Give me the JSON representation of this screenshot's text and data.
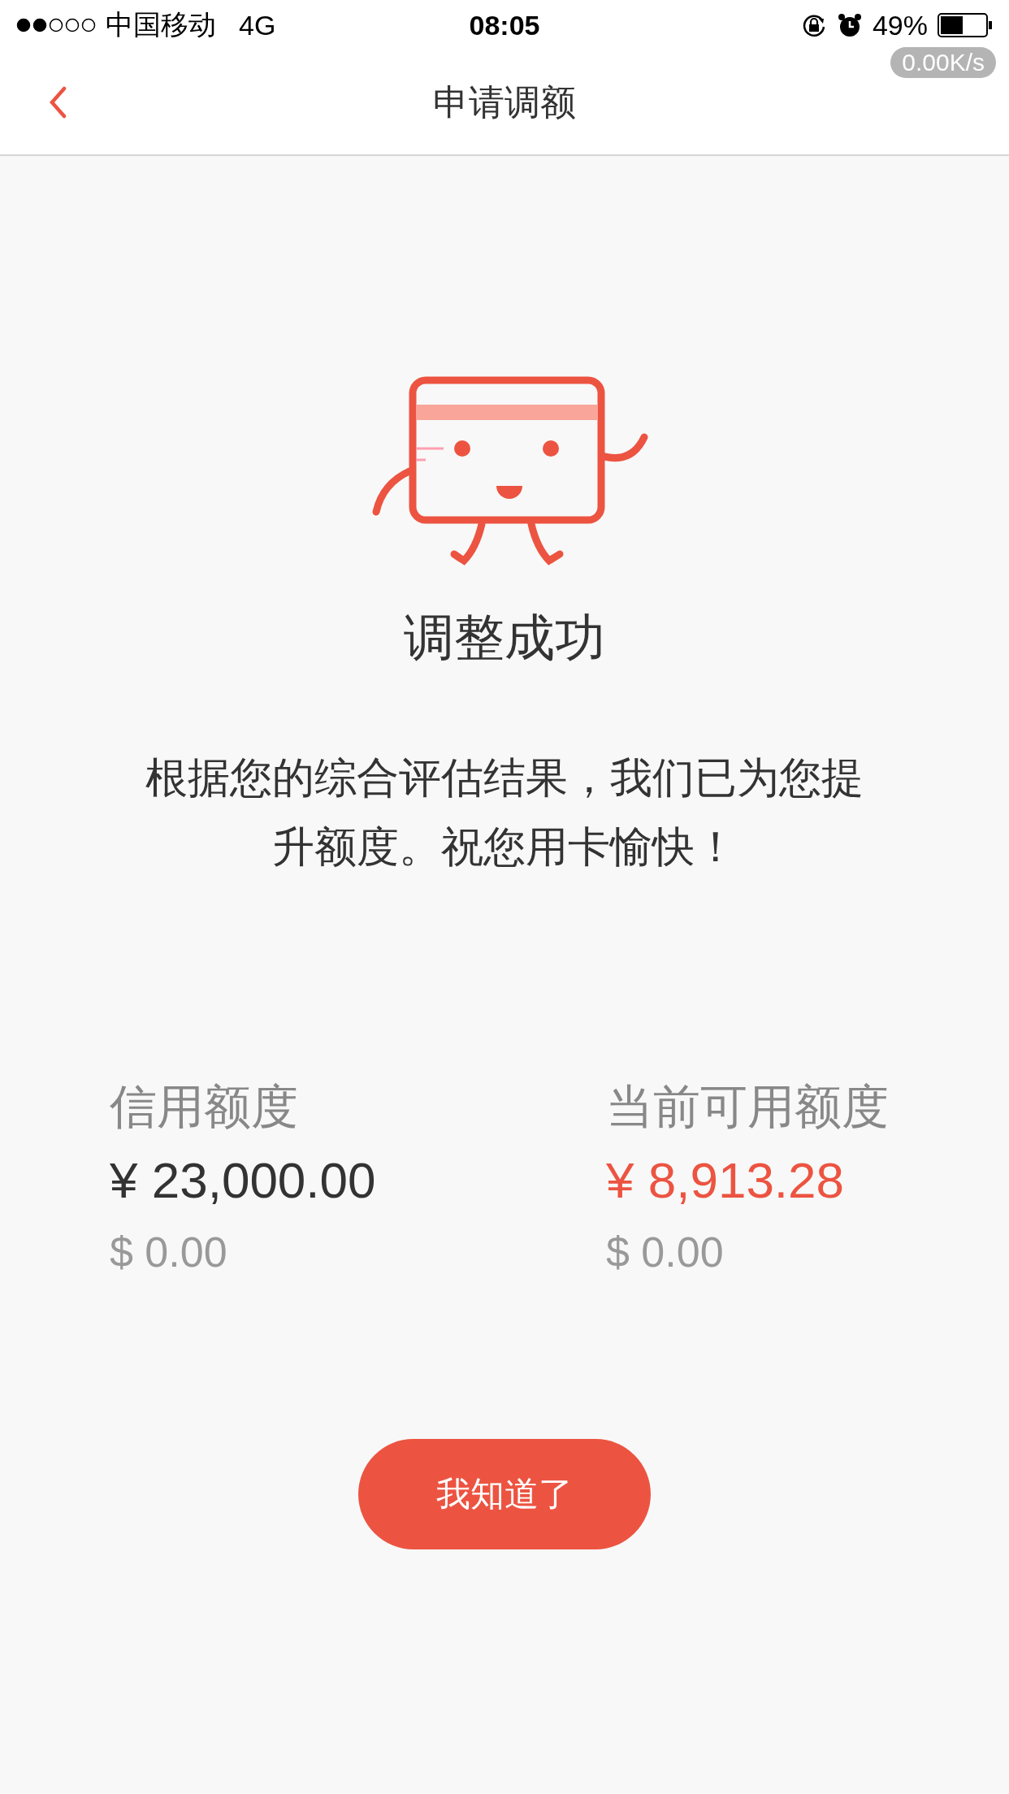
{
  "status_bar": {
    "carrier": "中国移动",
    "network": "4G",
    "time": "08:05",
    "battery": "49%",
    "speed": "0.00K/s"
  },
  "nav": {
    "title": "申请调额"
  },
  "result": {
    "title": "调整成功",
    "message": "根据您的综合评估结果，我们已为您提升额度。祝您用卡愉快！"
  },
  "limits": [
    {
      "label": "信用额度",
      "amount": "¥ 23,000.00",
      "usd": "$ 0.00",
      "highlight": false
    },
    {
      "label": "当前可用额度",
      "amount": "¥ 8,913.28",
      "usd": "$ 0.00",
      "highlight": true
    }
  ],
  "button": {
    "label": "我知道了"
  }
}
